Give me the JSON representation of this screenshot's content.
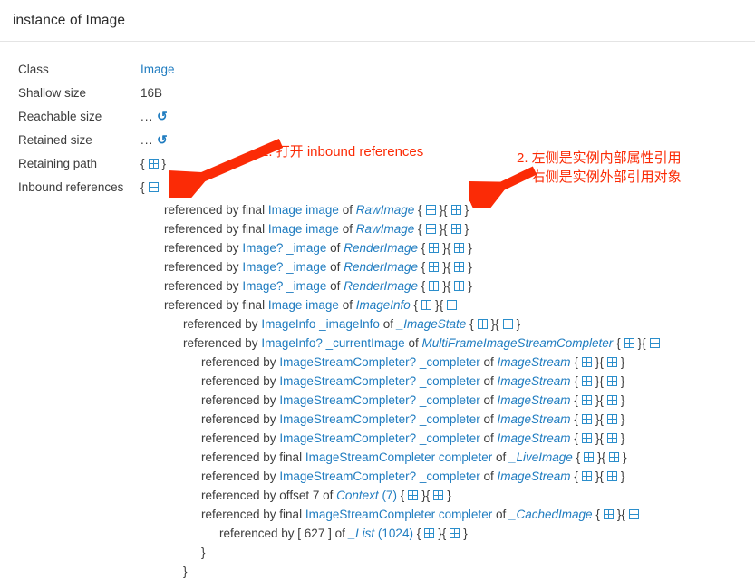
{
  "header": {
    "title": "instance of Image"
  },
  "properties": [
    {
      "label": "Class",
      "value": "Image",
      "kind": "link"
    },
    {
      "label": "Shallow size",
      "value": "16B",
      "kind": "text"
    },
    {
      "label": "Reachable size",
      "value": "...",
      "kind": "refresh",
      "icon": "refresh-icon"
    },
    {
      "label": "Retained size",
      "value": "...",
      "kind": "refresh",
      "icon": "refresh-icon"
    },
    {
      "label": "Retaining path",
      "value": "",
      "kind": "expander",
      "icon": "expand-box-icon",
      "state": "collapsed"
    },
    {
      "label": "Inbound references",
      "value": "",
      "kind": "expander",
      "icon": "collapse-box-icon",
      "state": "expanded"
    }
  ],
  "tree": [
    {
      "level": 0,
      "prefix": "referenced by final",
      "field_type": "Image",
      "field": "image",
      "of": "of",
      "owner": "RawImage",
      "count": "",
      "left": "expand",
      "right": "expand"
    },
    {
      "level": 0,
      "prefix": "referenced by final",
      "field_type": "Image",
      "field": "image",
      "of": "of",
      "owner": "RawImage",
      "count": "",
      "left": "expand",
      "right": "expand"
    },
    {
      "level": 0,
      "prefix": "referenced by",
      "field_type": "Image?",
      "field": "_image",
      "of": "of",
      "owner": "RenderImage",
      "count": "",
      "left": "expand",
      "right": "expand"
    },
    {
      "level": 0,
      "prefix": "referenced by",
      "field_type": "Image?",
      "field": "_image",
      "of": "of",
      "owner": "RenderImage",
      "count": "",
      "left": "expand",
      "right": "expand"
    },
    {
      "level": 0,
      "prefix": "referenced by",
      "field_type": "Image?",
      "field": "_image",
      "of": "of",
      "owner": "RenderImage",
      "count": "",
      "left": "expand",
      "right": "expand"
    },
    {
      "level": 0,
      "prefix": "referenced by final",
      "field_type": "Image",
      "field": "image",
      "of": "of",
      "owner": "ImageInfo",
      "count": "",
      "left": "expand",
      "right": "collapse",
      "open": true
    },
    {
      "level": 1,
      "prefix": "referenced by",
      "field_type": "ImageInfo",
      "field": "_imageInfo",
      "of": "of",
      "owner": "_ImageState",
      "count": "",
      "left": "expand",
      "right": "expand"
    },
    {
      "level": 1,
      "prefix": "referenced by",
      "field_type": "ImageInfo?",
      "field": "_currentImage",
      "of": "of",
      "owner": "MultiFrameImageStreamCompleter",
      "count": "",
      "left": "expand",
      "right": "collapse",
      "open": true
    },
    {
      "level": 2,
      "prefix": "referenced by",
      "field_type": "ImageStreamCompleter?",
      "field": "_completer",
      "of": "of",
      "owner": "ImageStream",
      "count": "",
      "left": "expand",
      "right": "expand"
    },
    {
      "level": 2,
      "prefix": "referenced by",
      "field_type": "ImageStreamCompleter?",
      "field": "_completer",
      "of": "of",
      "owner": "ImageStream",
      "count": "",
      "left": "expand",
      "right": "expand"
    },
    {
      "level": 2,
      "prefix": "referenced by",
      "field_type": "ImageStreamCompleter?",
      "field": "_completer",
      "of": "of",
      "owner": "ImageStream",
      "count": "",
      "left": "expand",
      "right": "expand"
    },
    {
      "level": 2,
      "prefix": "referenced by",
      "field_type": "ImageStreamCompleter?",
      "field": "_completer",
      "of": "of",
      "owner": "ImageStream",
      "count": "",
      "left": "expand",
      "right": "expand"
    },
    {
      "level": 2,
      "prefix": "referenced by",
      "field_type": "ImageStreamCompleter?",
      "field": "_completer",
      "of": "of",
      "owner": "ImageStream",
      "count": "",
      "left": "expand",
      "right": "expand"
    },
    {
      "level": 2,
      "prefix": "referenced by final",
      "field_type": "ImageStreamCompleter",
      "field": "completer",
      "of": "of",
      "owner": "_LiveImage",
      "count": "",
      "left": "expand",
      "right": "expand"
    },
    {
      "level": 2,
      "prefix": "referenced by",
      "field_type": "ImageStreamCompleter?",
      "field": "_completer",
      "of": "of",
      "owner": "ImageStream",
      "count": "",
      "left": "expand",
      "right": "expand"
    },
    {
      "level": 2,
      "prefix": "referenced by offset 7",
      "field_type": "",
      "field": "",
      "of": "of",
      "owner": "Context",
      "count": "(7)",
      "left": "expand",
      "right": "expand"
    },
    {
      "level": 2,
      "prefix": "referenced by final",
      "field_type": "ImageStreamCompleter",
      "field": "completer",
      "of": "of",
      "owner": "_CachedImage",
      "count": "",
      "left": "expand",
      "right": "collapse",
      "open": true
    },
    {
      "level": 3,
      "prefix": "referenced by [ 627 ]",
      "field_type": "",
      "field": "",
      "of": "of",
      "owner": "_List",
      "count": "(1024)",
      "left": "expand",
      "right": "expand"
    }
  ],
  "closing_braces": [
    {
      "level": 2,
      "text": "}"
    },
    {
      "level": 1,
      "text": "}"
    }
  ],
  "annotations": [
    {
      "id": "annot-1",
      "text": "1. 打开 inbound references"
    },
    {
      "id": "annot-2",
      "text": "2. 左侧是实例内部属性引用\n右侧是实例外部引用对象"
    }
  ],
  "colors": {
    "link": "#1f7cc0",
    "annotation": "#fb2b06",
    "text": "#3c3c3c",
    "divider": "#e4e4e4"
  }
}
